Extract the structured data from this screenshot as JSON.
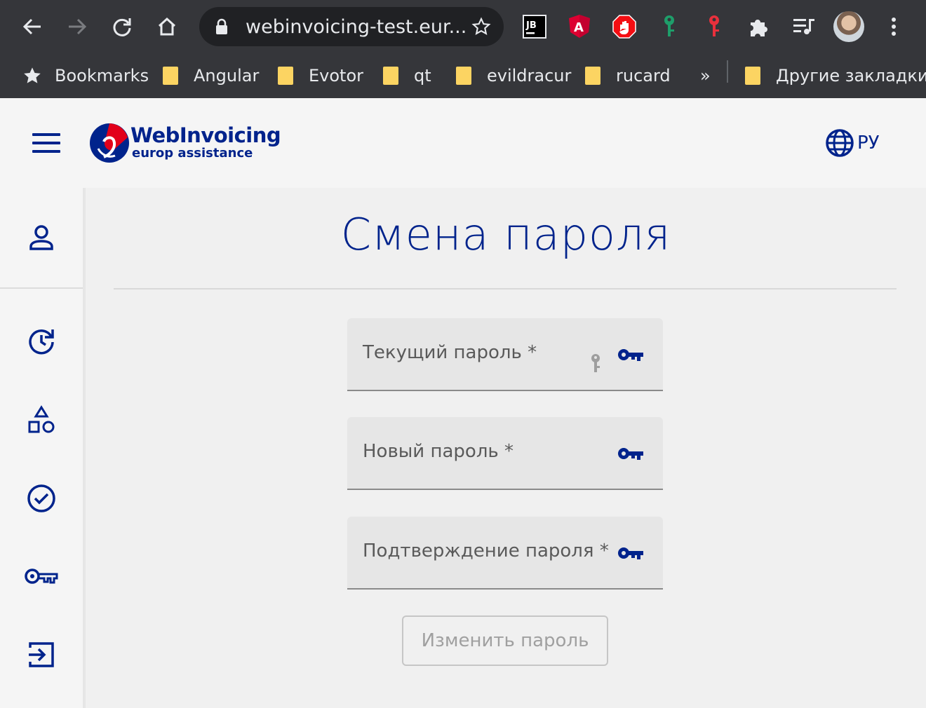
{
  "browser": {
    "url": "webinvoicing-test.eur...",
    "bookmarks": [
      {
        "label": "Bookmarks",
        "icon": "star-icon"
      },
      {
        "label": "Angular",
        "icon": "folder-icon"
      },
      {
        "label": "Evotor",
        "icon": "folder-icon"
      },
      {
        "label": "qt",
        "icon": "folder-icon"
      },
      {
        "label": "evildracur",
        "icon": "folder-icon"
      },
      {
        "label": "rucard",
        "icon": "folder-icon"
      }
    ],
    "overflow": "»",
    "other_bookmarks": "Другие закладки",
    "extensions": [
      "jetbrains-icon",
      "angular-icon",
      "adblock-icon",
      "green-key-icon",
      "red-key-icon",
      "puzzle-icon",
      "media-icon"
    ]
  },
  "header": {
    "logo_title": "WebInvoicing",
    "logo_subtitle": "europ assistance",
    "language": "РУ",
    "brand_color": "#00238c",
    "accent_color": "#e2001a"
  },
  "sidebar": {
    "items": [
      {
        "name": "profile",
        "icon": "user-icon"
      },
      {
        "name": "history",
        "icon": "history-icon"
      },
      {
        "name": "categories",
        "icon": "shapes-icon"
      },
      {
        "name": "approved",
        "icon": "check-circle-icon"
      },
      {
        "name": "change-password",
        "icon": "key-icon"
      },
      {
        "name": "logout",
        "icon": "logout-icon"
      }
    ]
  },
  "page": {
    "title": "Смена пароля",
    "fields": [
      {
        "label": "Текущий пароль *",
        "icon": "key-icon"
      },
      {
        "label": "Новый пароль *",
        "icon": "key-icon"
      },
      {
        "label": "Подтверждение пароля *",
        "icon": "key-icon"
      }
    ],
    "submit_label": "Изменить пароль"
  }
}
